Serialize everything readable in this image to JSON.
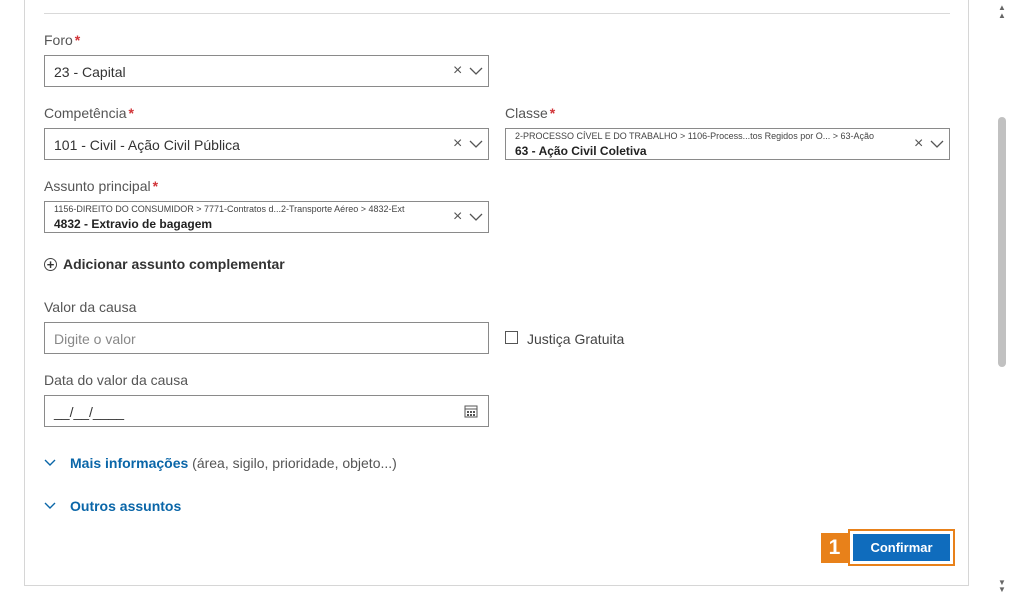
{
  "form": {
    "foro": {
      "label": "Foro",
      "value": "23 - Capital"
    },
    "competencia": {
      "label": "Competência",
      "value": "101 - Civil - Ação Civil Pública"
    },
    "classe": {
      "label": "Classe",
      "path": "2-PROCESSO CÍVEL E DO TRABALHO > 1106-Process...tos Regidos por O... > 63-Ação",
      "value": "63 - Ação Civil Coletiva"
    },
    "assunto": {
      "label": "Assunto principal",
      "path": "1156-DIREITO DO CONSUMIDOR > 7771-Contratos d...2-Transporte Aéreo > 4832-Ext",
      "value": "4832 - Extravio de bagagem"
    },
    "add_assunto": "Adicionar assunto complementar",
    "valor": {
      "label": "Valor da causa",
      "placeholder": "Digite o valor"
    },
    "justica": {
      "label": "Justiça Gratuita",
      "checked": false
    },
    "data_valor": {
      "label": "Data do valor da causa",
      "value": "__/__/____"
    },
    "mais_info": {
      "label": "Mais informações",
      "sub": "(área, sigilo, prioridade, objeto...)"
    },
    "outros": {
      "label": "Outros assuntos"
    },
    "required_mark": "*"
  },
  "annotation": {
    "step": "1",
    "button_label": "Confirmar"
  },
  "colors": {
    "accent": "#0f6cbd",
    "highlight": "#e8811a",
    "required": "#d13438"
  }
}
